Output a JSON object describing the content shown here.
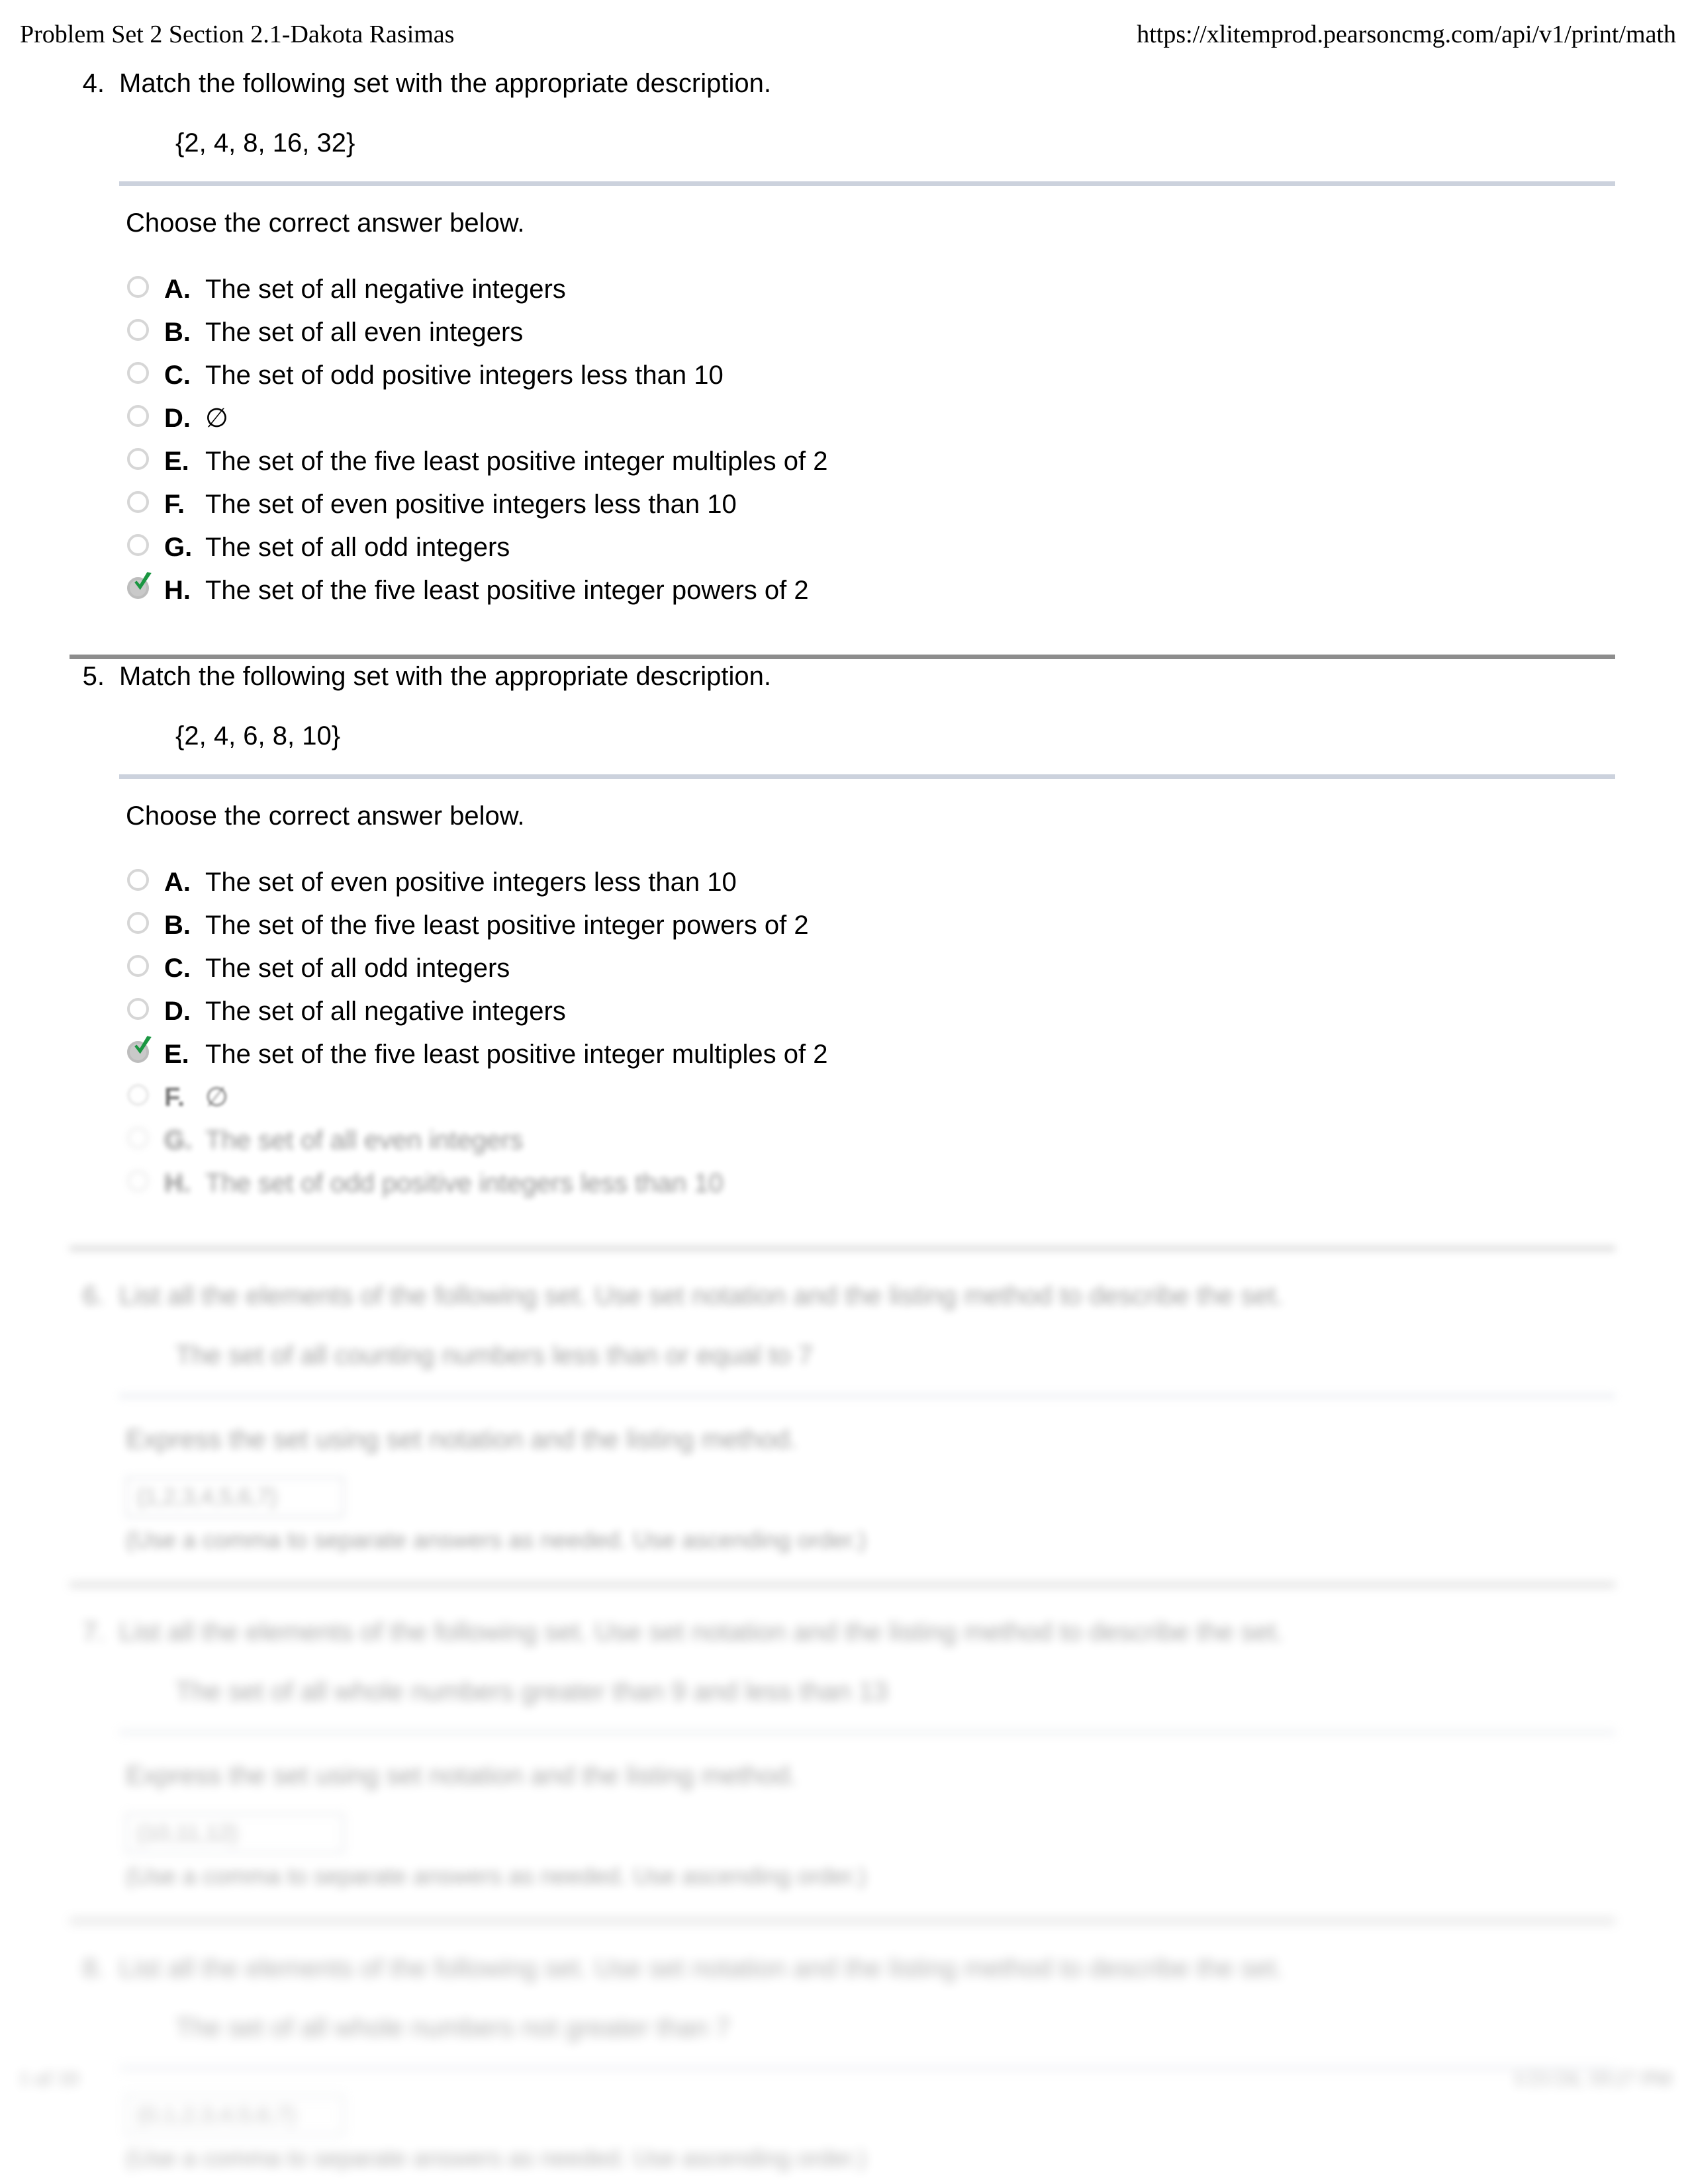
{
  "header": {
    "title": "Problem Set 2 Section 2.1-Dakota Rasimas",
    "url": "https://xlitemprod.pearsoncmg.com/api/v1/print/math"
  },
  "colors": {
    "light_rule": "#ccd2dd",
    "strong_rule": "#8d8d8d",
    "check_green": "#1a9641",
    "radio_gray": "#d6d6d6"
  },
  "questions": [
    {
      "number": "4.",
      "prompt": "Match the following set with the appropriate description.",
      "set_notation": "{2, 4, 8, 16, 32}",
      "choose_label": "Choose the correct answer below.",
      "options": [
        {
          "letter": "A.",
          "text": "The set of all negative integers",
          "selected": false
        },
        {
          "letter": "B.",
          "text": "The set of all even integers",
          "selected": false
        },
        {
          "letter": "C.",
          "text": "The set of odd positive integers less than 10",
          "selected": false
        },
        {
          "letter": "D.",
          "text": "∅",
          "selected": false
        },
        {
          "letter": "E.",
          "text": "The set of the five least positive integer multiples of 2",
          "selected": false
        },
        {
          "letter": "F.",
          "text": "The set of even positive integers less than 10",
          "selected": false
        },
        {
          "letter": "G.",
          "text": "The set of all odd integers",
          "selected": false
        },
        {
          "letter": "H.",
          "text": "The set of the five least positive integer powers of 2",
          "selected": true
        }
      ]
    },
    {
      "number": "5.",
      "prompt": "Match the following set with the appropriate description.",
      "set_notation": "{2, 4, 6, 8, 10}",
      "choose_label": "Choose the correct answer below.",
      "options": [
        {
          "letter": "A.",
          "text": "The set of even positive integers less than 10",
          "selected": false
        },
        {
          "letter": "B.",
          "text": "The set of the five least positive integer powers of 2",
          "selected": false
        },
        {
          "letter": "C.",
          "text": "The set of all odd integers",
          "selected": false
        },
        {
          "letter": "D.",
          "text": "The set of all negative integers",
          "selected": false
        },
        {
          "letter": "E.",
          "text": "The set of the five least positive integer multiples of 2",
          "selected": true
        },
        {
          "letter": "F.",
          "text": "∅",
          "selected": false,
          "blur": "blur-1"
        },
        {
          "letter": "G.",
          "text": "The set of all even integers",
          "selected": false,
          "blur": "blur-2"
        },
        {
          "letter": "H.",
          "text": "The set of odd positive integers less than 10",
          "selected": false,
          "blur": "blur-2"
        }
      ]
    }
  ],
  "blurred_questions": [
    {
      "number": "6.",
      "prompt": "List all the elements of the following set. Use set notation and the listing method to describe the set.",
      "set_notation": "The set of all counting numbers less than or equal to 7",
      "instruct": "Express the set using set notation and the listing method.",
      "answer_value": "{1,2,3,4,5,6,7}",
      "note": "(Use a comma to separate answers as needed. Use ascending order.)"
    },
    {
      "number": "7.",
      "prompt": "List all the elements of the following set. Use set notation and the listing method to describe the set.",
      "set_notation": "The set of all whole numbers greater than 9 and less than 13",
      "instruct": "Express the set using set notation and the listing method.",
      "answer_value": "{10,11,12}",
      "note": "(Use a comma to separate answers as needed. Use ascending order.)"
    },
    {
      "number": "8.",
      "prompt": "List all the elements of the following set. Use set notation and the listing method to describe the set.",
      "set_notation": "The set of all whole numbers not greater than 7",
      "instruct": "",
      "answer_value": "{0,1,2,3,4,5,6,7}",
      "note": "(Use a comma to separate answers as needed. Use ascending order.)"
    }
  ],
  "footer": {
    "left": "1 of 10",
    "right": "1/21/24, 10:27 PM"
  }
}
